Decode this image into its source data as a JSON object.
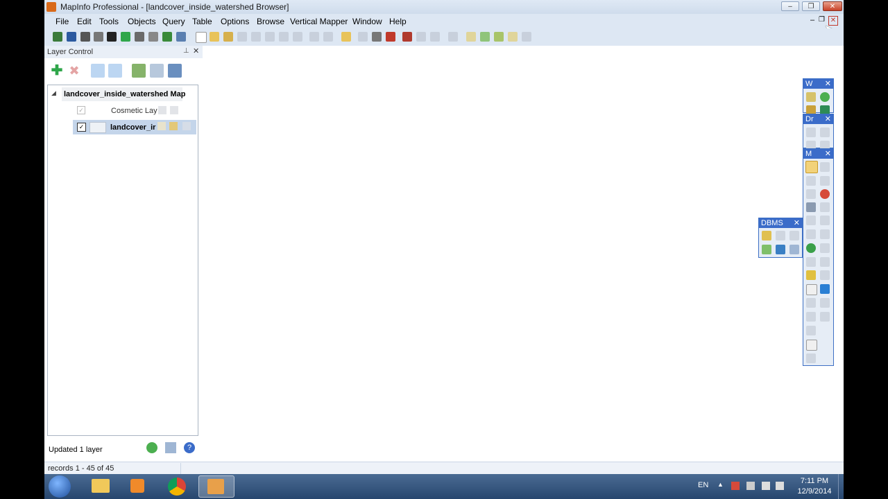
{
  "window": {
    "title": "MapInfo Professional - [landcover_inside_watershed Browser]"
  },
  "menu": [
    "File",
    "Edit",
    "Tools",
    "Objects",
    "Query",
    "Table",
    "Options",
    "Browse",
    "Vertical Mapper",
    "Window",
    "Help"
  ],
  "layer_control": {
    "title": "Layer Control",
    "map_name": "landcover_inside_watershed Map",
    "layers": [
      {
        "label": "Cosmetic Lay",
        "checked": true,
        "bold": false
      },
      {
        "label": "landcover_ir",
        "checked": true,
        "bold": true
      }
    ],
    "status": "Updated 1 layer"
  },
  "statusbar": {
    "records": "records 1 - 45 of 45"
  },
  "floating_toolbars": {
    "w": "W",
    "dr": "Dr",
    "m": "M",
    "dbms": "DBMS"
  },
  "taskbar": {
    "lang": "EN",
    "time": "7:11 PM",
    "date": "12/9/2014"
  },
  "colors": {
    "accent": "#3b6cc9",
    "title_bg": "#dfe9f5"
  }
}
